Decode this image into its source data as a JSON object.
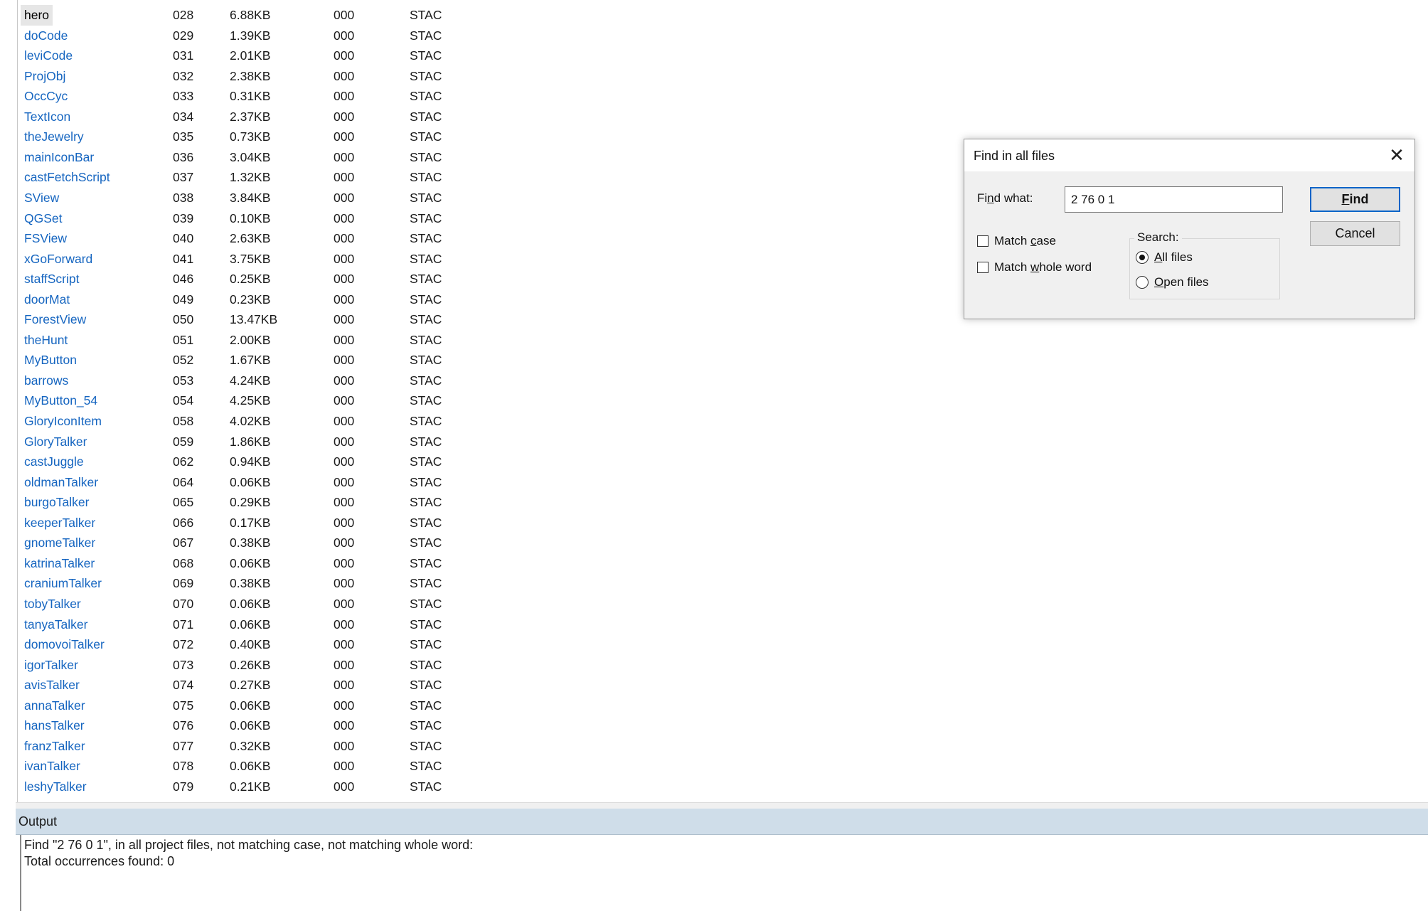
{
  "resource_list": {
    "rows": [
      {
        "name": "hero",
        "num": "028",
        "size": "6.88KB",
        "flag": "000",
        "type": "STAC",
        "selected": true
      },
      {
        "name": "doCode",
        "num": "029",
        "size": "1.39KB",
        "flag": "000",
        "type": "STAC"
      },
      {
        "name": "leviCode",
        "num": "031",
        "size": "2.01KB",
        "flag": "000",
        "type": "STAC"
      },
      {
        "name": "ProjObj",
        "num": "032",
        "size": "2.38KB",
        "flag": "000",
        "type": "STAC"
      },
      {
        "name": "OccCyc",
        "num": "033",
        "size": "0.31KB",
        "flag": "000",
        "type": "STAC"
      },
      {
        "name": "TextIcon",
        "num": "034",
        "size": "2.37KB",
        "flag": "000",
        "type": "STAC"
      },
      {
        "name": "theJewelry",
        "num": "035",
        "size": "0.73KB",
        "flag": "000",
        "type": "STAC"
      },
      {
        "name": "mainIconBar",
        "num": "036",
        "size": "3.04KB",
        "flag": "000",
        "type": "STAC"
      },
      {
        "name": "castFetchScript",
        "num": "037",
        "size": "1.32KB",
        "flag": "000",
        "type": "STAC"
      },
      {
        "name": "SView",
        "num": "038",
        "size": "3.84KB",
        "flag": "000",
        "type": "STAC"
      },
      {
        "name": "QGSet",
        "num": "039",
        "size": "0.10KB",
        "flag": "000",
        "type": "STAC"
      },
      {
        "name": "FSView",
        "num": "040",
        "size": "2.63KB",
        "flag": "000",
        "type": "STAC"
      },
      {
        "name": "xGoForward",
        "num": "041",
        "size": "3.75KB",
        "flag": "000",
        "type": "STAC"
      },
      {
        "name": "staffScript",
        "num": "046",
        "size": "0.25KB",
        "flag": "000",
        "type": "STAC"
      },
      {
        "name": "doorMat",
        "num": "049",
        "size": "0.23KB",
        "flag": "000",
        "type": "STAC"
      },
      {
        "name": "ForestView",
        "num": "050",
        "size": "13.47KB",
        "flag": "000",
        "type": "STAC"
      },
      {
        "name": "theHunt",
        "num": "051",
        "size": "2.00KB",
        "flag": "000",
        "type": "STAC"
      },
      {
        "name": "MyButton",
        "num": "052",
        "size": "1.67KB",
        "flag": "000",
        "type": "STAC"
      },
      {
        "name": "barrows",
        "num": "053",
        "size": "4.24KB",
        "flag": "000",
        "type": "STAC"
      },
      {
        "name": "MyButton_54",
        "num": "054",
        "size": "4.25KB",
        "flag": "000",
        "type": "STAC"
      },
      {
        "name": "GloryIconItem",
        "num": "058",
        "size": "4.02KB",
        "flag": "000",
        "type": "STAC"
      },
      {
        "name": "GloryTalker",
        "num": "059",
        "size": "1.86KB",
        "flag": "000",
        "type": "STAC"
      },
      {
        "name": "castJuggle",
        "num": "062",
        "size": "0.94KB",
        "flag": "000",
        "type": "STAC"
      },
      {
        "name": "oldmanTalker",
        "num": "064",
        "size": "0.06KB",
        "flag": "000",
        "type": "STAC"
      },
      {
        "name": "burgoTalker",
        "num": "065",
        "size": "0.29KB",
        "flag": "000",
        "type": "STAC"
      },
      {
        "name": "keeperTalker",
        "num": "066",
        "size": "0.17KB",
        "flag": "000",
        "type": "STAC"
      },
      {
        "name": "gnomeTalker",
        "num": "067",
        "size": "0.38KB",
        "flag": "000",
        "type": "STAC"
      },
      {
        "name": "katrinaTalker",
        "num": "068",
        "size": "0.06KB",
        "flag": "000",
        "type": "STAC"
      },
      {
        "name": "craniumTalker",
        "num": "069",
        "size": "0.38KB",
        "flag": "000",
        "type": "STAC"
      },
      {
        "name": "tobyTalker",
        "num": "070",
        "size": "0.06KB",
        "flag": "000",
        "type": "STAC"
      },
      {
        "name": "tanyaTalker",
        "num": "071",
        "size": "0.06KB",
        "flag": "000",
        "type": "STAC"
      },
      {
        "name": "domovoiTalker",
        "num": "072",
        "size": "0.40KB",
        "flag": "000",
        "type": "STAC"
      },
      {
        "name": "igorTalker",
        "num": "073",
        "size": "0.26KB",
        "flag": "000",
        "type": "STAC"
      },
      {
        "name": "avisTalker",
        "num": "074",
        "size": "0.27KB",
        "flag": "000",
        "type": "STAC"
      },
      {
        "name": "annaTalker",
        "num": "075",
        "size": "0.06KB",
        "flag": "000",
        "type": "STAC"
      },
      {
        "name": "hansTalker",
        "num": "076",
        "size": "0.06KB",
        "flag": "000",
        "type": "STAC"
      },
      {
        "name": "franzTalker",
        "num": "077",
        "size": "0.32KB",
        "flag": "000",
        "type": "STAC"
      },
      {
        "name": "ivanTalker",
        "num": "078",
        "size": "0.06KB",
        "flag": "000",
        "type": "STAC"
      },
      {
        "name": "leshyTalker",
        "num": "079",
        "size": "0.21KB",
        "flag": "000",
        "type": "STAC"
      }
    ]
  },
  "output": {
    "title": "Output",
    "lines": [
      "Find \"2 76 0 1\", in all project files, not matching case, not matching whole word:",
      "Total occurrences found: 0"
    ]
  },
  "dialog": {
    "title": "Find in all files",
    "close_glyph": "✕",
    "find_what_label": "Find what:",
    "find_what_value": "2 76 0 1",
    "find_button": "Find",
    "cancel_button": "Cancel",
    "match_case_label": "Match case",
    "match_case_checked": false,
    "match_whole_word_label": "Match whole word",
    "match_whole_word_checked": false,
    "search_group_label": "Search:",
    "search_all_files_label": "All files",
    "search_open_files_label": "Open files",
    "search_selected": "All files"
  },
  "colors": {
    "link_blue": "#1565c0",
    "output_header": "#cfdde9",
    "dialog_bg": "#f0f0f0",
    "default_button_border": "#0a64c8"
  },
  "icons": {
    "close": "close-icon",
    "checkbox": "checkbox-icon",
    "radio": "radio-icon"
  }
}
